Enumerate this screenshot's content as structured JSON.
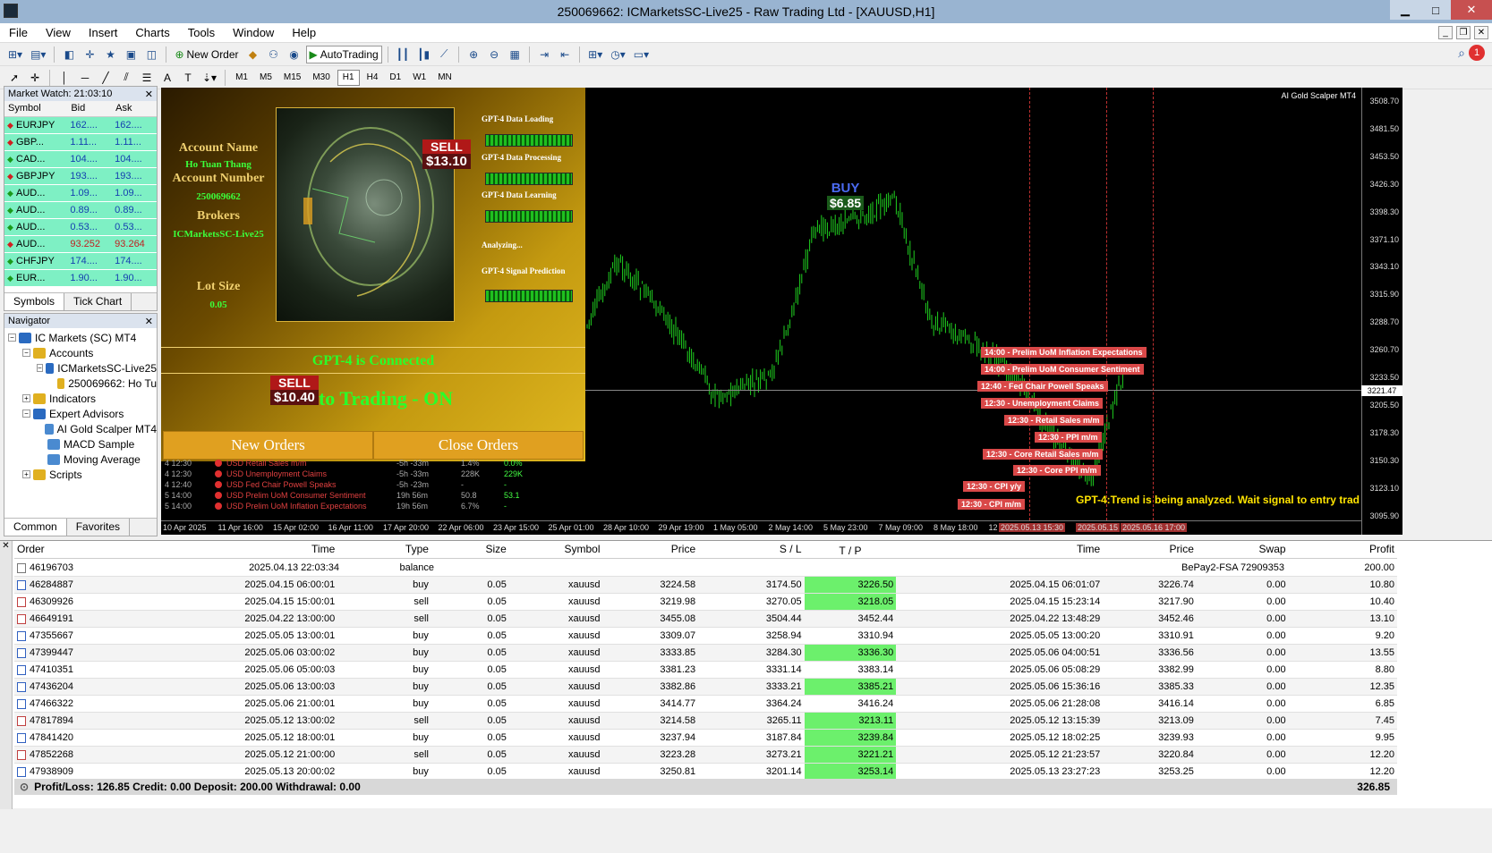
{
  "window": {
    "title": "250069662: ICMarketsSC-Live25 - Raw Trading Ltd - [XAUUSD,H1]"
  },
  "menu": [
    "File",
    "View",
    "Insert",
    "Charts",
    "Tools",
    "Window",
    "Help"
  ],
  "toolbar": {
    "new_order": "New Order",
    "autotrading": "AutoTrading"
  },
  "timeframes": [
    "M1",
    "M5",
    "M15",
    "M30",
    "H1",
    "H4",
    "D1",
    "W1",
    "MN"
  ],
  "active_timeframe": "H1",
  "market_watch": {
    "title": "Market Watch: 21:03:10",
    "cols": [
      "Symbol",
      "Bid",
      "Ask"
    ],
    "rows": [
      {
        "sym": "EURJPY",
        "bid": "162....",
        "ask": "162....",
        "dir": "down"
      },
      {
        "sym": "GBP...",
        "bid": "1.11...",
        "ask": "1.11...",
        "dir": "down"
      },
      {
        "sym": "CAD...",
        "bid": "104....",
        "ask": "104....",
        "dir": "up"
      },
      {
        "sym": "GBPJPY",
        "bid": "193....",
        "ask": "193....",
        "dir": "down"
      },
      {
        "sym": "AUD...",
        "bid": "1.09...",
        "ask": "1.09...",
        "dir": "up"
      },
      {
        "sym": "AUD...",
        "bid": "0.89...",
        "ask": "0.89...",
        "dir": "up"
      },
      {
        "sym": "AUD...",
        "bid": "0.53...",
        "ask": "0.53...",
        "dir": "up"
      },
      {
        "sym": "AUD...",
        "bid": "93.252",
        "ask": "93.264",
        "dir": "down"
      },
      {
        "sym": "CHFJPY",
        "bid": "174....",
        "ask": "174....",
        "dir": "up"
      },
      {
        "sym": "EUR...",
        "bid": "1.90...",
        "ask": "1.90...",
        "dir": "up"
      }
    ],
    "tabs": [
      "Symbols",
      "Tick Chart"
    ]
  },
  "navigator": {
    "title": "Navigator",
    "items": [
      {
        "label": "IC Markets (SC) MT4",
        "level": 0
      },
      {
        "label": "Accounts",
        "level": 1
      },
      {
        "label": "ICMarketsSC-Live25",
        "level": 2
      },
      {
        "label": "250069662: Ho Tu",
        "level": 3
      },
      {
        "label": "Indicators",
        "level": 1
      },
      {
        "label": "Expert Advisors",
        "level": 1
      },
      {
        "label": "AI Gold Scalper MT4",
        "level": 2
      },
      {
        "label": "MACD Sample",
        "level": 2
      },
      {
        "label": "Moving Average",
        "level": 2
      },
      {
        "label": "Scripts",
        "level": 1
      }
    ],
    "tabs": [
      "Common",
      "Favorites"
    ]
  },
  "ea_panel": {
    "account_name_label": "Account Name",
    "account_name": "Ho Tuan Thang",
    "account_number_label": "Account Number",
    "account_number": "250069662",
    "brokers_label": "Brokers",
    "broker": "ICMarketsSC-Live25",
    "lot_label": "Lot Size",
    "lot": "0.05",
    "steps": [
      "GPT-4 Data Loading",
      "GPT-4 Data Processing",
      "GPT-4 Data Learning",
      "Analyzing...",
      "GPT-4 Signal Prediction"
    ],
    "connected": "GPT-4 is Connected",
    "autotrading": "Auto Trading - ON",
    "new_orders": "New Orders",
    "close_orders": "Close Orders",
    "sell_tag": "SELL",
    "sell_value": "$13.10",
    "sell2_value": "$10.40"
  },
  "news": [
    {
      "d": "4 12:30",
      "name": "USD Retail Sales m/m",
      "t": "-5h -33m",
      "f": "1.4%",
      "p": "0.0%"
    },
    {
      "d": "4 12:30",
      "name": "USD Unemployment Claims",
      "t": "-5h -33m",
      "f": "228K",
      "p": "229K"
    },
    {
      "d": "4 12:40",
      "name": "USD Fed Chair Powell Speaks",
      "t": "-5h -23m",
      "f": "-",
      "p": "-"
    },
    {
      "d": "5 14:00",
      "name": "USD Prelim UoM Consumer Sentiment",
      "t": "19h 56m",
      "f": "50.8",
      "p": "53.1"
    },
    {
      "d": "5 14:00",
      "name": "USD Prelim UoM Inflation Expectations",
      "t": "19h 56m",
      "f": "6.7%",
      "p": "-"
    }
  ],
  "chart": {
    "ea_name": "AI Gold Scalper MT4",
    "current_price": "3221.47",
    "buy_label": "BUY",
    "buy_value": "$6.85",
    "analyze_text": "GPT-4:Trend is being analyzed. Wait signal to entry trad",
    "yticks": [
      "3508.70",
      "3481.50",
      "3453.50",
      "3426.30",
      "3398.30",
      "3371.10",
      "3343.10",
      "3315.90",
      "3288.70",
      "3260.70",
      "3233.50",
      "3205.50",
      "3178.30",
      "3150.30",
      "3123.10",
      "3095.90"
    ],
    "xticks": [
      "10 Apr 2025",
      "11 Apr 16:00",
      "15 Apr 02:00",
      "16 Apr 11:00",
      "17 Apr 20:00",
      "22 Apr 06:00",
      "23 Apr 15:00",
      "25 Apr 01:00",
      "28 Apr 10:00",
      "29 Apr 19:00",
      "1 May 05:00",
      "2 May 14:00",
      "5 May 23:00",
      "7 May 09:00",
      "8 May 18:00",
      "12 May"
    ],
    "xmarks": [
      "2025.05.13 15:30",
      "2025.05.15",
      "2025.05.16 17:00"
    ],
    "events": [
      "14:00 - Prelim UoM Inflation Expectations",
      "14:00 - Prelim UoM Consumer Sentiment",
      "12:40 - Fed Chair Powell Speaks",
      "12:30 - Unemployment Claims",
      "12:30 - Retail Sales m/m",
      "12:30 - PPI m/m",
      "12:30 - Core Retail Sales m/m",
      "12:30 - Core PPI m/m",
      "12:30 - CPI y/y",
      "12:30 - CPI m/m"
    ]
  },
  "terminal": {
    "cols": [
      "Order",
      "Time",
      "Type",
      "Size",
      "Symbol",
      "Price",
      "S / L",
      "T / P",
      "Time",
      "Price",
      "Swap",
      "Profit"
    ],
    "balance_row": {
      "order": "46196703",
      "time": "2025.04.13 22:03:34",
      "type": "balance",
      "comment": "BePay2-FSA 72909353",
      "profit": "200.00"
    },
    "rows": [
      {
        "order": "46284887",
        "time": "2025.04.15 06:00:01",
        "type": "buy",
        "size": "0.05",
        "sym": "xauusd",
        "price": "3224.58",
        "sl": "3174.50",
        "tp": "3226.50",
        "tph": true,
        "ctime": "2025.04.15 06:01:07",
        "cprice": "3226.74",
        "swap": "0.00",
        "profit": "10.80"
      },
      {
        "order": "46309926",
        "time": "2025.04.15 15:00:01",
        "type": "sell",
        "size": "0.05",
        "sym": "xauusd",
        "price": "3219.98",
        "sl": "3270.05",
        "tp": "3218.05",
        "tph": true,
        "ctime": "2025.04.15 15:23:14",
        "cprice": "3217.90",
        "swap": "0.00",
        "profit": "10.40"
      },
      {
        "order": "46649191",
        "time": "2025.04.22 13:00:00",
        "type": "sell",
        "size": "0.05",
        "sym": "xauusd",
        "price": "3455.08",
        "sl": "3504.44",
        "tp": "3452.44",
        "tph": false,
        "ctime": "2025.04.22 13:48:29",
        "cprice": "3452.46",
        "swap": "0.00",
        "profit": "13.10"
      },
      {
        "order": "47355667",
        "time": "2025.05.05 13:00:01",
        "type": "buy",
        "size": "0.05",
        "sym": "xauusd",
        "price": "3309.07",
        "sl": "3258.94",
        "tp": "3310.94",
        "tph": false,
        "ctime": "2025.05.05 13:00:20",
        "cprice": "3310.91",
        "swap": "0.00",
        "profit": "9.20"
      },
      {
        "order": "47399447",
        "time": "2025.05.06 03:00:02",
        "type": "buy",
        "size": "0.05",
        "sym": "xauusd",
        "price": "3333.85",
        "sl": "3284.30",
        "tp": "3336.30",
        "tph": true,
        "ctime": "2025.05.06 04:00:51",
        "cprice": "3336.56",
        "swap": "0.00",
        "profit": "13.55"
      },
      {
        "order": "47410351",
        "time": "2025.05.06 05:00:03",
        "type": "buy",
        "size": "0.05",
        "sym": "xauusd",
        "price": "3381.23",
        "sl": "3331.14",
        "tp": "3383.14",
        "tph": false,
        "ctime": "2025.05.06 05:08:29",
        "cprice": "3382.99",
        "swap": "0.00",
        "profit": "8.80"
      },
      {
        "order": "47436204",
        "time": "2025.05.06 13:00:03",
        "type": "buy",
        "size": "0.05",
        "sym": "xauusd",
        "price": "3382.86",
        "sl": "3333.21",
        "tp": "3385.21",
        "tph": true,
        "ctime": "2025.05.06 15:36:16",
        "cprice": "3385.33",
        "swap": "0.00",
        "profit": "12.35"
      },
      {
        "order": "47466322",
        "time": "2025.05.06 21:00:01",
        "type": "buy",
        "size": "0.05",
        "sym": "xauusd",
        "price": "3414.77",
        "sl": "3364.24",
        "tp": "3416.24",
        "tph": false,
        "ctime": "2025.05.06 21:28:08",
        "cprice": "3416.14",
        "swap": "0.00",
        "profit": "6.85"
      },
      {
        "order": "47817894",
        "time": "2025.05.12 13:00:02",
        "type": "sell",
        "size": "0.05",
        "sym": "xauusd",
        "price": "3214.58",
        "sl": "3265.11",
        "tp": "3213.11",
        "tph": true,
        "ctime": "2025.05.12 13:15:39",
        "cprice": "3213.09",
        "swap": "0.00",
        "profit": "7.45"
      },
      {
        "order": "47841420",
        "time": "2025.05.12 18:00:01",
        "type": "buy",
        "size": "0.05",
        "sym": "xauusd",
        "price": "3237.94",
        "sl": "3187.84",
        "tp": "3239.84",
        "tph": true,
        "ctime": "2025.05.12 18:02:25",
        "cprice": "3239.93",
        "swap": "0.00",
        "profit": "9.95"
      },
      {
        "order": "47852268",
        "time": "2025.05.12 21:00:00",
        "type": "sell",
        "size": "0.05",
        "sym": "xauusd",
        "price": "3223.28",
        "sl": "3273.21",
        "tp": "3221.21",
        "tph": true,
        "ctime": "2025.05.12 21:23:57",
        "cprice": "3220.84",
        "swap": "0.00",
        "profit": "12.20"
      },
      {
        "order": "47938909",
        "time": "2025.05.13 20:00:02",
        "type": "buy",
        "size": "0.05",
        "sym": "xauusd",
        "price": "3250.81",
        "sl": "3201.14",
        "tp": "3253.14",
        "tph": true,
        "ctime": "2025.05.13 23:27:23",
        "cprice": "3253.25",
        "swap": "0.00",
        "profit": "12.20"
      }
    ],
    "summary": "Profit/Loss: 126.85  Credit: 0.00  Deposit: 200.00  Withdrawal: 0.00",
    "total": "326.85"
  }
}
